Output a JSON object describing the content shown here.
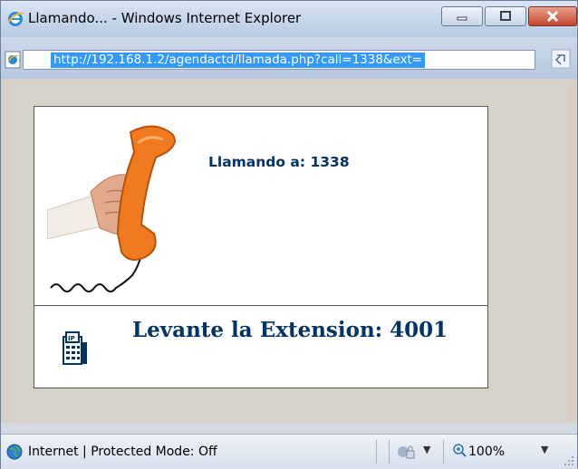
{
  "window": {
    "title": "Llamando... - Windows Internet Explorer"
  },
  "address_bar": {
    "url": "http://192.168.1.2/agendactd/llamada.php?call=1338&ext="
  },
  "page": {
    "calling_label": "Llamando a: 1338",
    "extension_label": "Levante la Extension: 4001"
  },
  "status_bar": {
    "zone_text": "Internet | Protected Mode: Off",
    "zoom_level": "100%"
  },
  "icons": {
    "title": "ie-logo-icon",
    "address": "page-icon",
    "refresh": "refresh-icon",
    "phone": "phone-handset-image",
    "extension": "ip-phone-icon",
    "zone": "globe-icon",
    "security": "lock-icon",
    "zoom": "zoom-icon"
  },
  "colors": {
    "accent": "#003366",
    "selection": "#3399ff"
  }
}
